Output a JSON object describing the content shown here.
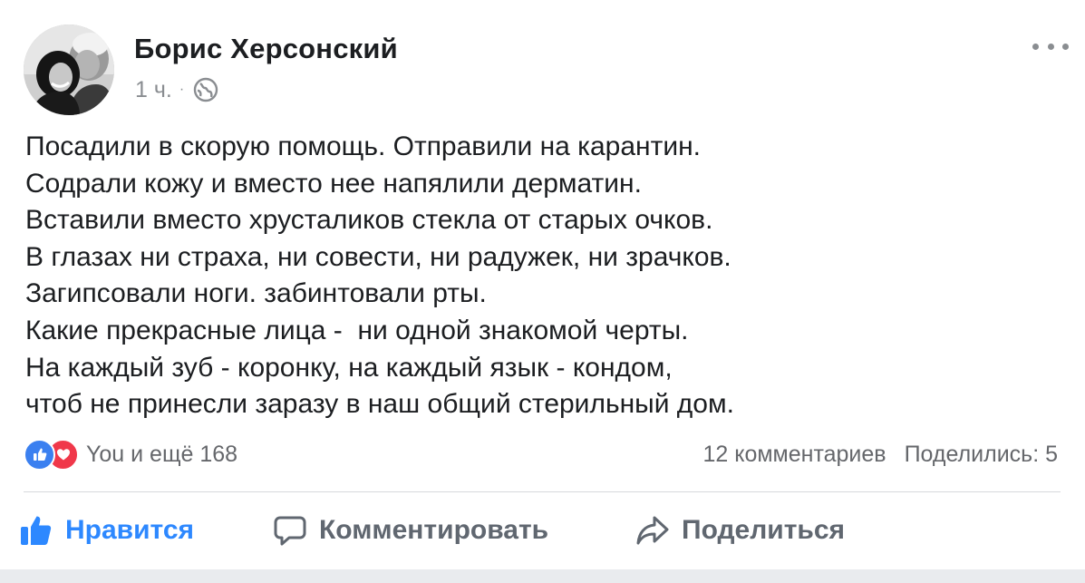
{
  "post": {
    "author": "Борис Херсонский",
    "time": "1 ч.",
    "separator": "·",
    "privacy_icon": "globe-icon",
    "more_icon": "ellipsis-icon",
    "lines": [
      "Посадили в скорую помощь. Отправили на карантин.",
      "Содрали кожу и вместо нее напялили дерматин.",
      "Вставили вместо хрусталиков стекла от старых очков.",
      "В глазах ни страха, ни совести, ни радужек, ни зрачков.",
      "Загипсовали ноги. забинтовали рты.",
      "Какие прекрасные лица -  ни одной знакомой черты.",
      "На каждый зуб - коронку, на каждый язык - кондом,",
      "чтоб не принесли заразу в наш общий стерильный дом."
    ]
  },
  "reactions": {
    "icons": [
      "like-reaction-icon",
      "love-reaction-icon"
    ],
    "summary": "You и ещё 168",
    "comments": "12 комментариев",
    "shares": "Поделились: 5"
  },
  "actions": {
    "like": "Нравится",
    "comment": "Комментировать",
    "share": "Поделиться"
  },
  "colors": {
    "like_active": "#2d88ff",
    "like_reaction": "#3b80f0",
    "love_reaction": "#f0384a",
    "secondary_text": "#65676b",
    "background": "#ffffff",
    "page_background": "#e9ebee"
  }
}
